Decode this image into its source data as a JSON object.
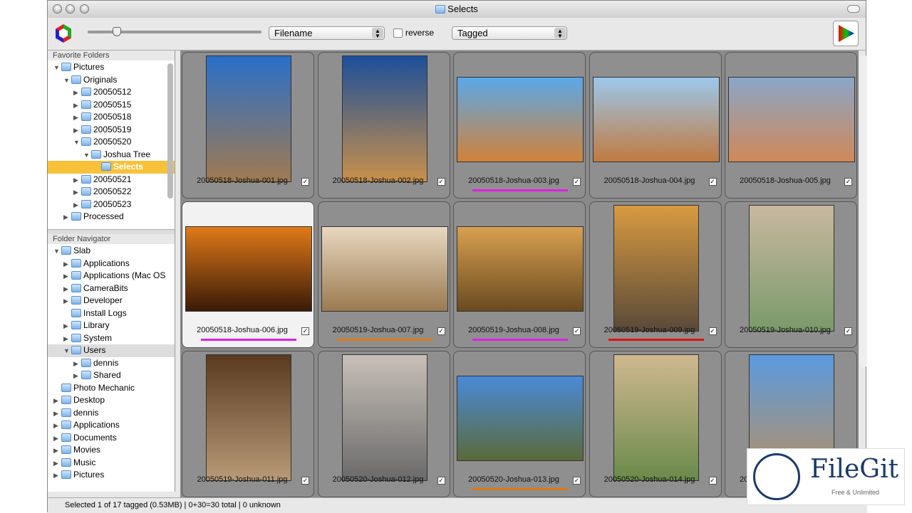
{
  "window": {
    "title": "Selects"
  },
  "toolbar": {
    "sort_field": "Filename",
    "reverse_label": "reverse",
    "filter": "Tagged",
    "thumb_size_percent": 17
  },
  "sidebar": {
    "favorites_title": "Favorite Folders",
    "favorites": [
      {
        "label": "Pictures",
        "level": 0,
        "tri": "down"
      },
      {
        "label": "Originals",
        "level": 1,
        "tri": "down"
      },
      {
        "label": "20050512",
        "level": 2,
        "tri": "right"
      },
      {
        "label": "20050515",
        "level": 2,
        "tri": "right"
      },
      {
        "label": "20050518",
        "level": 2,
        "tri": "right"
      },
      {
        "label": "20050519",
        "level": 2,
        "tri": "right"
      },
      {
        "label": "20050520",
        "level": 2,
        "tri": "down"
      },
      {
        "label": "Joshua Tree",
        "level": 3,
        "tri": "down"
      },
      {
        "label": "Selects",
        "level": 4,
        "tri": "",
        "selected": true
      },
      {
        "label": "20050521",
        "level": 2,
        "tri": "right"
      },
      {
        "label": "20050522",
        "level": 2,
        "tri": "right"
      },
      {
        "label": "20050523",
        "level": 2,
        "tri": "right"
      },
      {
        "label": "Processed",
        "level": 1,
        "tri": "right"
      }
    ],
    "navigator_title": "Folder Navigator",
    "navigator": [
      {
        "label": "Slab",
        "level": 0,
        "tri": "down"
      },
      {
        "label": "Applications",
        "level": 1,
        "tri": "right"
      },
      {
        "label": "Applications (Mac OS",
        "level": 1,
        "tri": "right"
      },
      {
        "label": "CameraBits",
        "level": 1,
        "tri": "right"
      },
      {
        "label": "Developer",
        "level": 1,
        "tri": "right"
      },
      {
        "label": "Install Logs",
        "level": 1,
        "tri": ""
      },
      {
        "label": "Library",
        "level": 1,
        "tri": "right"
      },
      {
        "label": "System",
        "level": 1,
        "tri": "right"
      },
      {
        "label": "Users",
        "level": 1,
        "tri": "down",
        "gray": true
      },
      {
        "label": "dennis",
        "level": 2,
        "tri": "right"
      },
      {
        "label": "Shared",
        "level": 2,
        "tri": "right"
      },
      {
        "label": "Photo Mechanic",
        "level": 0,
        "tri": ""
      },
      {
        "label": "Desktop",
        "level": 0,
        "tri": "right"
      },
      {
        "label": "dennis",
        "level": 0,
        "tri": "right"
      },
      {
        "label": "Applications",
        "level": 0,
        "tri": "right"
      },
      {
        "label": "Documents",
        "level": 0,
        "tri": "right"
      },
      {
        "label": "Movies",
        "level": 0,
        "tri": "right"
      },
      {
        "label": "Music",
        "level": 0,
        "tri": "right"
      },
      {
        "label": "Pictures",
        "level": 0,
        "tri": "right"
      }
    ]
  },
  "thumbnails": [
    {
      "filename": "20050518-Joshua-001.jpg",
      "orient": "portrait",
      "tagged": true,
      "colors": [
        "#2a6fc9",
        "#a07a50"
      ]
    },
    {
      "filename": "20050518-Joshua-002.jpg",
      "orient": "portrait",
      "tagged": true,
      "colors": [
        "#1c4f9a",
        "#c8904a"
      ]
    },
    {
      "filename": "20050518-Joshua-003.jpg",
      "orient": "landscape",
      "tagged": true,
      "label_color": "#e020e0",
      "colors": [
        "#5aa8e8",
        "#d0823a"
      ]
    },
    {
      "filename": "20050518-Joshua-004.jpg",
      "orient": "landscape",
      "tagged": true,
      "colors": [
        "#9cc8ec",
        "#c07a40"
      ]
    },
    {
      "filename": "20050518-Joshua-005.jpg",
      "orient": "landscape",
      "tagged": true,
      "colors": [
        "#8aa6c8",
        "#d08858"
      ]
    },
    {
      "filename": "20050518-Joshua-006.jpg",
      "orient": "landscape",
      "tagged": true,
      "selected": true,
      "label_color": "#e020e0",
      "colors": [
        "#e07a18",
        "#3a1a08"
      ]
    },
    {
      "filename": "20050519-Joshua-007.jpg",
      "orient": "landscape",
      "tagged": true,
      "label_color": "#e07a10",
      "colors": [
        "#e8d8c0",
        "#9a7a50"
      ]
    },
    {
      "filename": "20050519-Joshua-008.jpg",
      "orient": "landscape",
      "tagged": true,
      "label_color": "#e020e0",
      "colors": [
        "#d8a050",
        "#6a4a20"
      ]
    },
    {
      "filename": "20050519-Joshua-009.jpg",
      "orient": "portrait",
      "tagged": true,
      "label_color": "#e01010",
      "colors": [
        "#d89a40",
        "#5a4a3a"
      ]
    },
    {
      "filename": "20050519-Joshua-010.jpg",
      "orient": "portrait",
      "tagged": true,
      "colors": [
        "#c8b8a0",
        "#7a9a6a"
      ]
    },
    {
      "filename": "20050519-Joshua-011.jpg",
      "orient": "portrait",
      "tagged": true,
      "colors": [
        "#5a3a20",
        "#b89a78"
      ]
    },
    {
      "filename": "20050520-Joshua-012.jpg",
      "orient": "portrait",
      "tagged": true,
      "colors": [
        "#c8c0b8",
        "#6a6a6a"
      ]
    },
    {
      "filename": "20050520-Joshua-013.jpg",
      "orient": "landscape",
      "tagged": true,
      "label_color": "#e07a10",
      "colors": [
        "#4a8ad8",
        "#5a6a3a"
      ]
    },
    {
      "filename": "20050520-Joshua-014.jpg",
      "orient": "portrait",
      "tagged": true,
      "colors": [
        "#d0b890",
        "#6a8a4a"
      ]
    },
    {
      "filename": "20050520-Joshua-015.jpg",
      "orient": "portrait",
      "tagged": true,
      "colors": [
        "#5a9ae0",
        "#b89060"
      ]
    }
  ],
  "status": {
    "text": "Selected 1 of 17 tagged (0.53MB) | 0+30=30 total | 0 unknown"
  },
  "watermark": {
    "brand": "FileGit",
    "tagline": "Free & Unlimited"
  }
}
